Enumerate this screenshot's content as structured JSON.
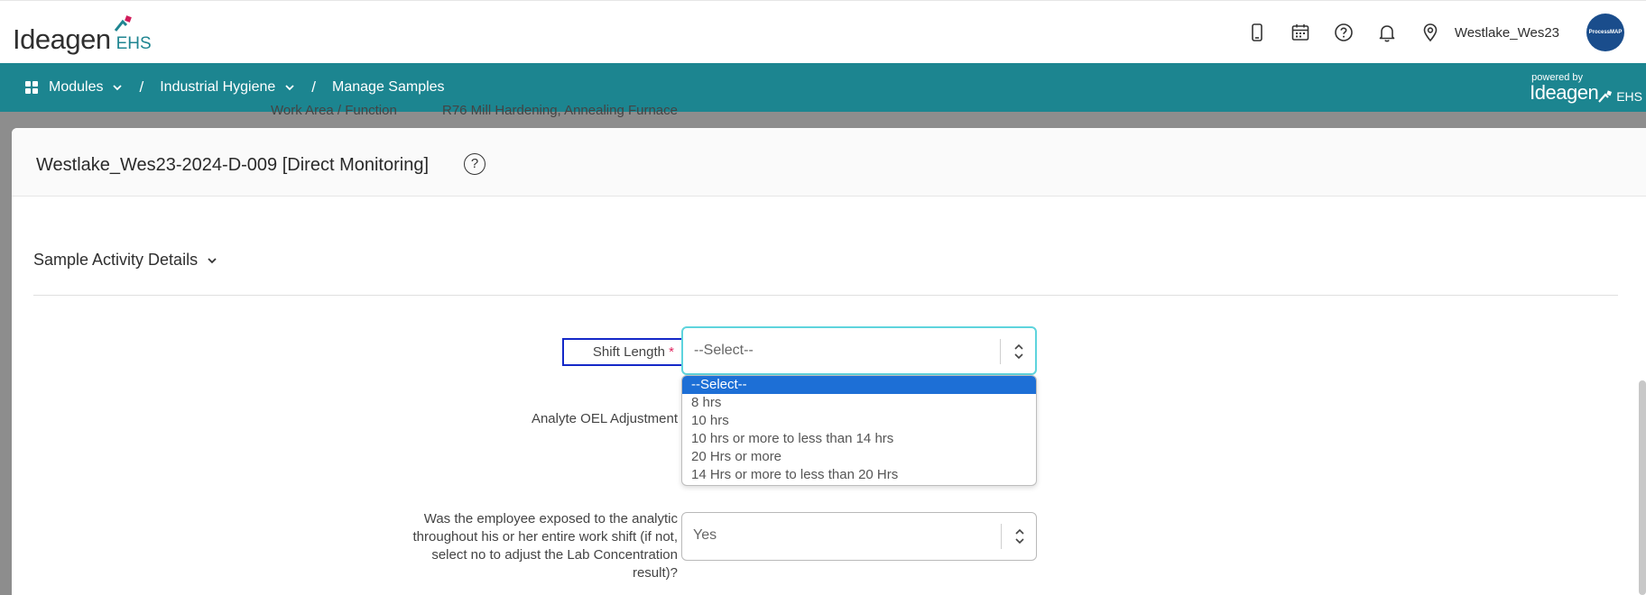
{
  "header": {
    "brand": "Ideagen",
    "brand_suffix": "EHS",
    "site": "Westlake_Wes23",
    "avatar_text": "ProcessMAP",
    "icons": [
      "mobile-icon",
      "calendar-icon",
      "help-icon",
      "bell-icon",
      "location-pin-icon"
    ]
  },
  "nav": {
    "modules": "Modules",
    "module": "Industrial Hygiene",
    "page": "Manage Samples",
    "powered_by": "powered by",
    "powered_brand": "Ideagen",
    "powered_suffix": "EHS"
  },
  "background": {
    "label": "Work Area / Function",
    "value": "R76 Mill Hardening, Annealing Furnace"
  },
  "modal": {
    "title": "Westlake_Wes23-2024-D-009 [Direct Monitoring]",
    "help": "?",
    "section": "Sample Activity Details"
  },
  "fields": {
    "shift_length": {
      "label": "Shift Length",
      "required": "*",
      "value": "--Select--",
      "options": [
        "--Select--",
        "8 hrs",
        "10 hrs",
        "10 hrs or more to less than 14 hrs",
        "20 Hrs or more",
        "14 Hrs or more to less than 20 Hrs"
      ],
      "selected_index": 0
    },
    "oel_adjustment": {
      "label": "Analyte OEL Adjustment"
    },
    "exposed": {
      "label": "Was the employee exposed to the analytic throughout his or her entire work shift (if not, select no to adjust the Lab Concentration result)?",
      "value": "Yes"
    }
  },
  "colors": {
    "nav_bg": "#1c8590",
    "brand_teal": "#1f8591",
    "focus_border": "#5ed4dd",
    "selected_option": "#1d6fd6",
    "highlight_box": "#1428c8",
    "required": "#e0245e"
  }
}
